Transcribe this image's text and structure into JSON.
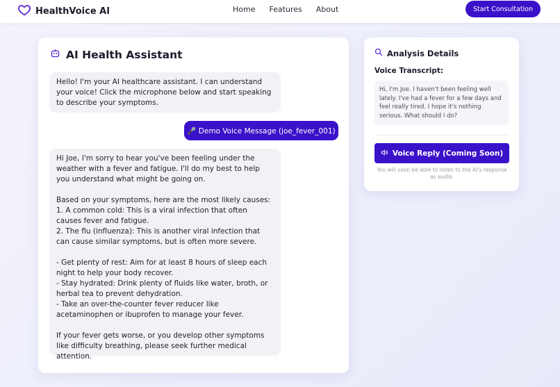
{
  "nav": {
    "brand": "HealthVoice AI",
    "links": [
      "Home",
      "Features",
      "About"
    ],
    "cta": "Start Consultation"
  },
  "chat": {
    "title": "AI Health Assistant",
    "messages": [
      {
        "role": "assistant",
        "text": "Hello! I'm your AI healthcare assistant. I can understand your voice! Click the microphone below and start speaking to describe your symptoms."
      },
      {
        "role": "user",
        "text": "🎤 Demo Voice Message (joe_fever_001)"
      },
      {
        "role": "assistant",
        "text": "Hi Joe, I'm sorry to hear you've been feeling under the weather with a fever and fatigue. I'll do my best to help you understand what might be going on.\n\nBased on your symptoms, here are the most likely causes:\n1. A common cold: This is a viral infection that often causes fever and fatigue.\n2. The flu (influenza): This is another viral infection that can cause similar symptoms, but is often more severe.\n\n- Get plenty of rest: Aim for at least 8 hours of sleep each night to help your body recover.\n- Stay hydrated: Drink plenty of fluids like water, broth, or herbal tea to prevent dehydration.\n- Take an over-the-counter fever reducer like acetaminophen or ibuprofen to manage your fever.\n\nIf your fever gets worse, or you develop other symptoms like difficulty breathing, please seek further medical attention."
      }
    ]
  },
  "analysis": {
    "title": "Analysis Details",
    "transcript_label": "Voice Transcript:",
    "transcript": "Hi, I'm Joe. I haven't been feeling well lately. I've had a fever for a few days and feel really tired. I hope it's nothing serious. What should I do?",
    "voice_reply_label": "Voice Reply (Coming Soon)",
    "voice_reply_note": "You will soon be able to listen to the AI's response as audio."
  },
  "colors": {
    "accent": "#3a12c9",
    "brand_heart": "#5b2bd6"
  }
}
